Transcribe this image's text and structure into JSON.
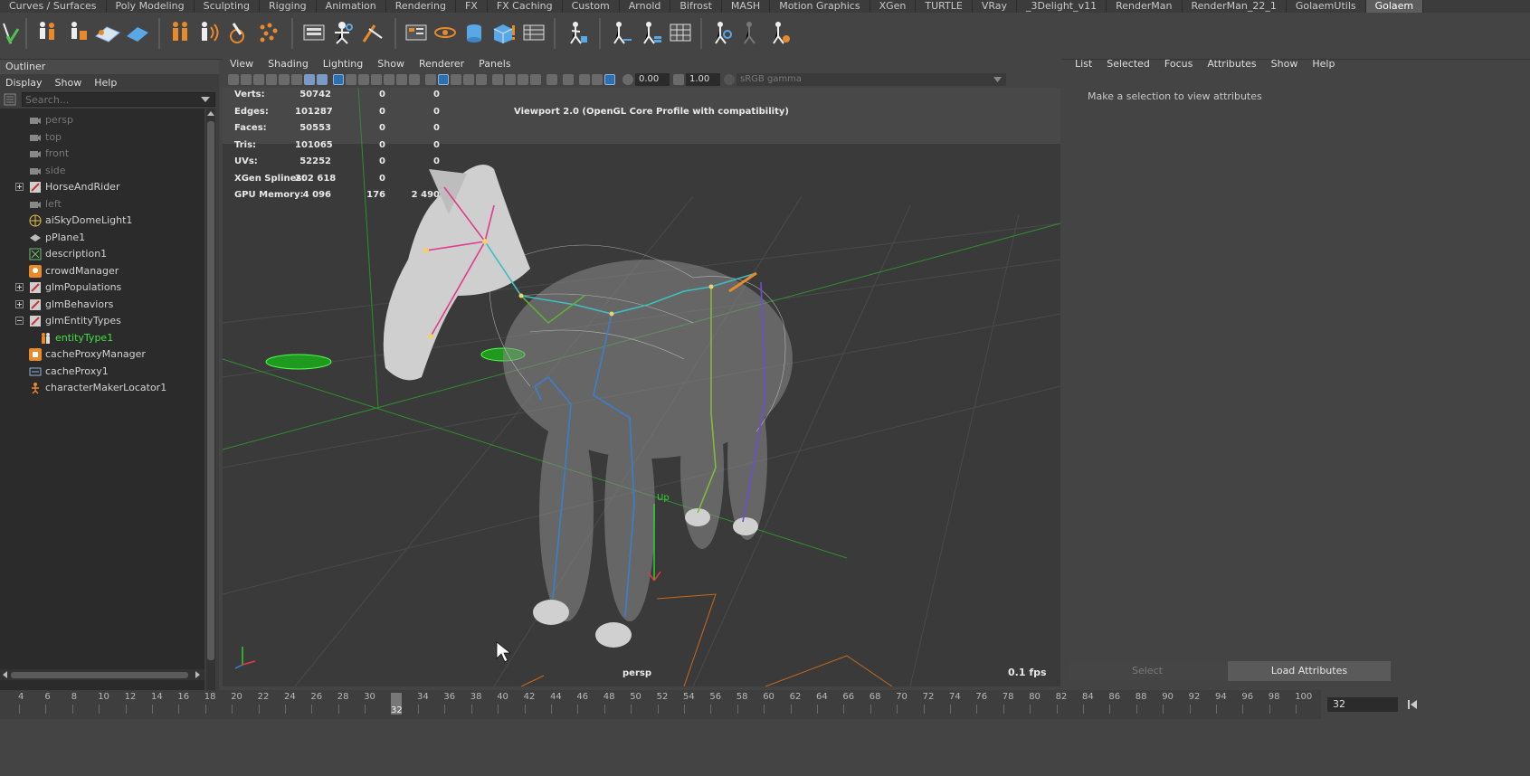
{
  "shelf_tabs": [
    "Curves / Surfaces",
    "Poly Modeling",
    "Sculpting",
    "Rigging",
    "Animation",
    "Rendering",
    "FX",
    "FX Caching",
    "Custom",
    "Arnold",
    "Bifrost",
    "MASH",
    "Motion Graphics",
    "XGen",
    "TURTLE",
    "VRay",
    "_3Delight_v11",
    "RenderMan",
    "RenderMan_22_1",
    "GolaemUtils",
    "Golaem"
  ],
  "active_shelf_tab": "Golaem",
  "outliner": {
    "title": "Outliner",
    "menu": [
      "Display",
      "Show",
      "Help"
    ],
    "search_placeholder": "Search...",
    "items": [
      {
        "label": "persp",
        "icon": "camera-icon",
        "dim": true
      },
      {
        "label": "top",
        "icon": "camera-icon",
        "dim": true
      },
      {
        "label": "front",
        "icon": "camera-icon",
        "dim": true
      },
      {
        "label": "side",
        "icon": "camera-icon",
        "dim": true
      },
      {
        "label": "HorseAndRider",
        "icon": "group-icon",
        "dim": false,
        "expander": "plus"
      },
      {
        "label": "left",
        "icon": "camera-icon",
        "dim": true
      },
      {
        "label": "aiSkyDomeLight1",
        "icon": "sky-dome-light-icon",
        "dim": false
      },
      {
        "label": "pPlane1",
        "icon": "poly-plane-icon",
        "dim": false
      },
      {
        "label": "description1",
        "icon": "xgen-description-icon",
        "dim": false
      },
      {
        "label": "crowdManager",
        "icon": "crowd-manager-icon",
        "dim": false
      },
      {
        "label": "glmPopulations",
        "icon": "group-icon",
        "dim": false,
        "expander": "plus"
      },
      {
        "label": "glmBehaviors",
        "icon": "group-icon",
        "dim": false,
        "expander": "plus"
      },
      {
        "label": "glmEntityTypes",
        "icon": "group-icon",
        "dim": false,
        "expander": "minus"
      },
      {
        "label": "entityType1",
        "icon": "entity-type-icon",
        "dim": false,
        "child": true
      },
      {
        "label": "cacheProxyManager",
        "icon": "cache-proxy-manager-icon",
        "dim": false
      },
      {
        "label": "cacheProxy1",
        "icon": "cache-proxy-icon",
        "dim": false
      },
      {
        "label": "characterMakerLocator1",
        "icon": "character-maker-icon",
        "dim": false
      }
    ]
  },
  "viewport": {
    "menu": [
      "View",
      "Shading",
      "Lighting",
      "Show",
      "Renderer",
      "Panels"
    ],
    "exposure": "0.00",
    "gamma": "1.00",
    "color_space": "sRGB gamma",
    "renderer_label": "Viewport 2.0 (OpenGL Core Profile with compatibility)",
    "camera_label": "persp",
    "fps": "0.1 fps",
    "manip_label": "Up",
    "hud": [
      {
        "label": "Verts:",
        "v1": "50742",
        "v2": "0",
        "v3": "0"
      },
      {
        "label": "Edges:",
        "v1": "101287",
        "v2": "0",
        "v3": "0"
      },
      {
        "label": "Faces:",
        "v1": "50553",
        "v2": "0",
        "v3": "0"
      },
      {
        "label": "Tris:",
        "v1": "101065",
        "v2": "0",
        "v3": "0"
      },
      {
        "label": "UVs:",
        "v1": "52252",
        "v2": "0",
        "v3": "0"
      },
      {
        "label": "XGen Splines:",
        "v1": "202 618",
        "v2": "0",
        "v3": ""
      },
      {
        "label": "GPU Memory:",
        "v1": "4 096",
        "v2": "176",
        "v3": "2 490"
      }
    ]
  },
  "attribute_editor": {
    "menu": [
      "List",
      "Selected",
      "Focus",
      "Attributes",
      "Show",
      "Help"
    ],
    "message": "Make a selection to view attributes",
    "select_label": "Select",
    "load_label": "Load Attributes"
  },
  "timeline": {
    "ticks": [
      "4",
      "6",
      "8",
      "10",
      "12",
      "14",
      "16",
      "18",
      "20",
      "22",
      "24",
      "26",
      "28",
      "30",
      "32",
      "34",
      "36",
      "38",
      "40",
      "42",
      "44",
      "46",
      "48",
      "50",
      "52",
      "54",
      "56",
      "58",
      "60",
      "62",
      "64",
      "66",
      "68",
      "70",
      "72",
      "74",
      "76",
      "78",
      "80",
      "82",
      "84",
      "86",
      "88",
      "90",
      "92",
      "94",
      "96",
      "98",
      "100"
    ],
    "current_frame": "32",
    "frame_field": "32"
  }
}
